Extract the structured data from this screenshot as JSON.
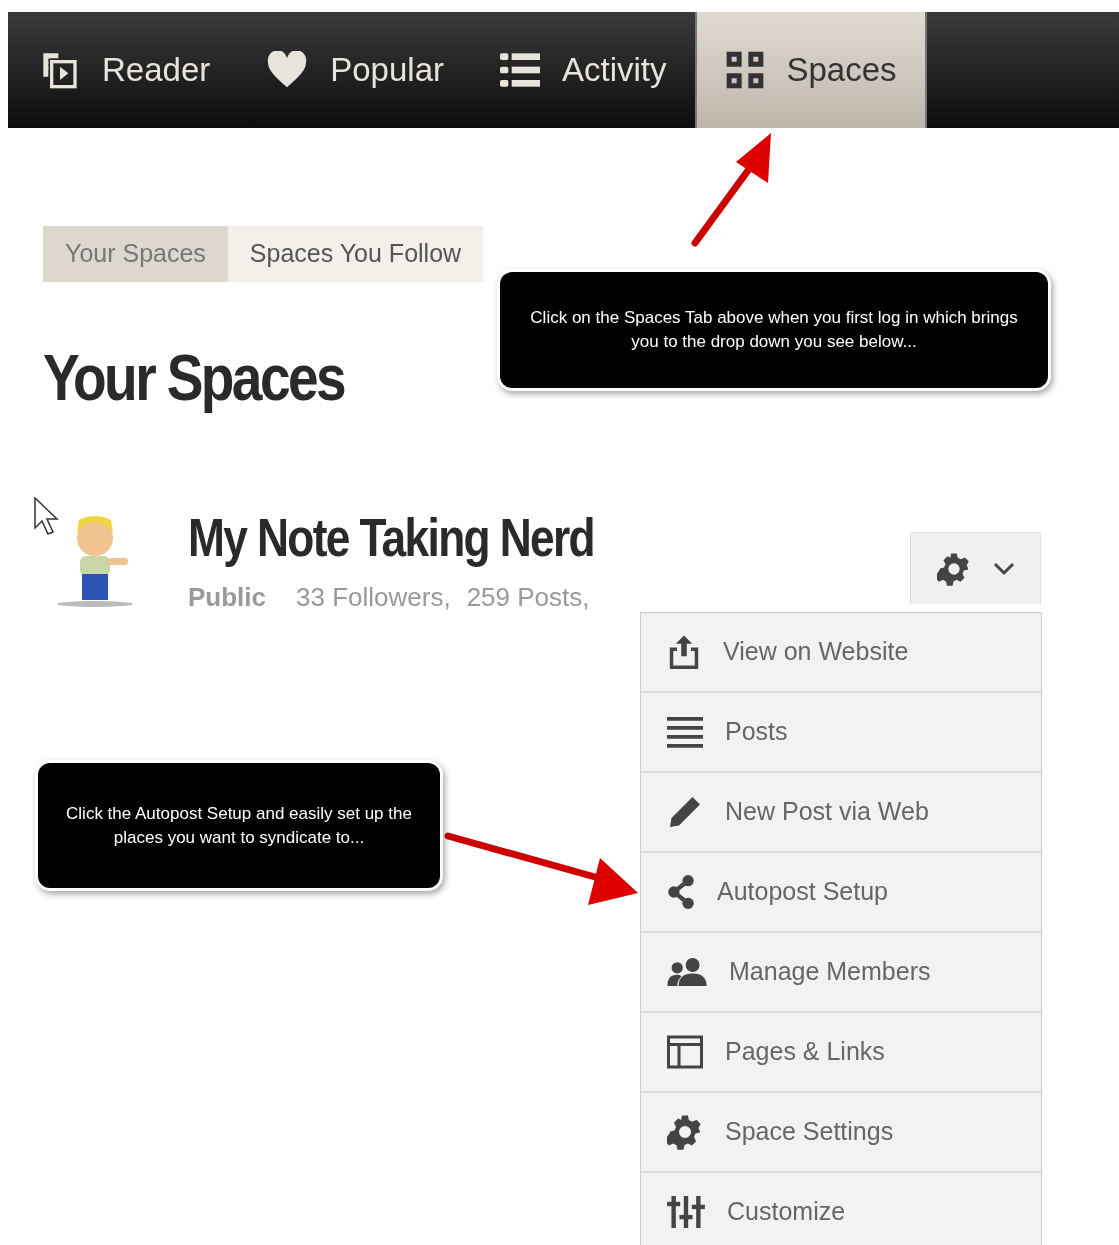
{
  "nav_tabs": [
    {
      "label": "Reader",
      "selected": false
    },
    {
      "label": "Popular",
      "selected": false
    },
    {
      "label": "Activity",
      "selected": false
    },
    {
      "label": "Spaces",
      "selected": true
    }
  ],
  "sub_tabs": [
    {
      "label": "Your Spaces",
      "selected": true
    },
    {
      "label": "Spaces You Follow",
      "selected": false
    }
  ],
  "heading": "Your Spaces",
  "space": {
    "title": "My Note Taking Nerd",
    "visibility": "Public",
    "followers": "33 Followers,",
    "posts": "259 Posts,"
  },
  "menu": {
    "expanded": true,
    "items": [
      {
        "label": "View on Website"
      },
      {
        "label": "Posts"
      },
      {
        "label": "New Post via Web"
      },
      {
        "label": "Autopost Setup"
      },
      {
        "label": "Manage Members"
      },
      {
        "label": "Pages & Links"
      },
      {
        "label": "Space Settings"
      },
      {
        "label": "Customize"
      }
    ]
  },
  "callouts": [
    {
      "text": "Click on the Spaces Tab above when you first log in which brings you to the drop down you see below..."
    },
    {
      "text": "Click the Autopost Setup and easily set up the places you want to syndicate to..."
    }
  ]
}
